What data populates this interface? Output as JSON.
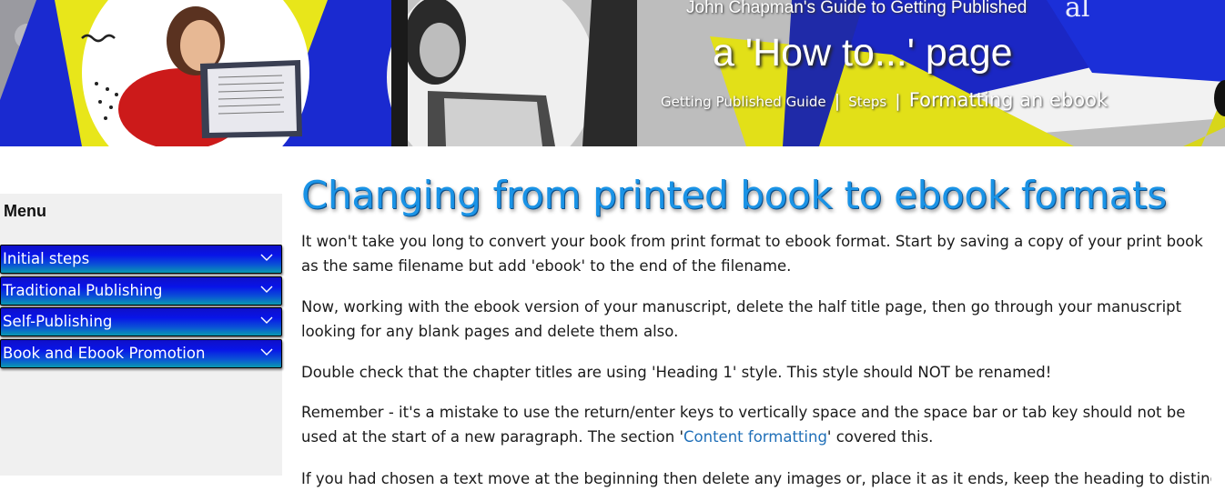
{
  "banner": {
    "site_title": "John Chapman's Guide to Getting Published",
    "heading": "a 'How to...' page",
    "breadcrumb": {
      "items": [
        "Getting Published Guide",
        "Steps"
      ],
      "separator": "|",
      "current": "Formatting an ebook"
    }
  },
  "sidebar": {
    "menu_title": "Menu",
    "items": [
      {
        "label": "Initial steps",
        "icon": "chevron-down-icon"
      },
      {
        "label": "Traditional Publishing",
        "icon": "chevron-down-icon"
      },
      {
        "label": "Self-Publishing",
        "icon": "chevron-down-icon"
      },
      {
        "label": "Book and Ebook Promotion",
        "icon": "chevron-down-icon"
      }
    ]
  },
  "main": {
    "title": "Changing from printed book to ebook formats",
    "paragraphs": [
      "It won't take you long to convert your book from print format to ebook format. Start by saving a copy of your print book as the same filename but add 'ebook' to the end of the filename.",
      "Now, working with the ebook version of your manuscript, delete the half title page, then go through your manuscript looking for any blank pages and delete them also.",
      "Double check that the chapter titles are using 'Heading 1' style. This style should NOT be renamed!"
    ],
    "paragraph4": {
      "before": "Remember - it's a mistake to use the return/enter keys to vertically space and the space bar or tab key should not be used at the start of a new paragraph. The section '",
      "link": "Content formatting",
      "after": "' covered this."
    },
    "paragraph5_partial": "If you had chosen a text move at the beginning then delete any images or, place it as it ends, keep the heading to distinguish"
  },
  "colors": {
    "title_blue": "#1a93e6",
    "menu_gradient_top": "#1010c8",
    "menu_gradient_bottom": "#0a9ab0",
    "link": "#1f6fb8",
    "sidebar_bg": "#f0f0f0"
  }
}
